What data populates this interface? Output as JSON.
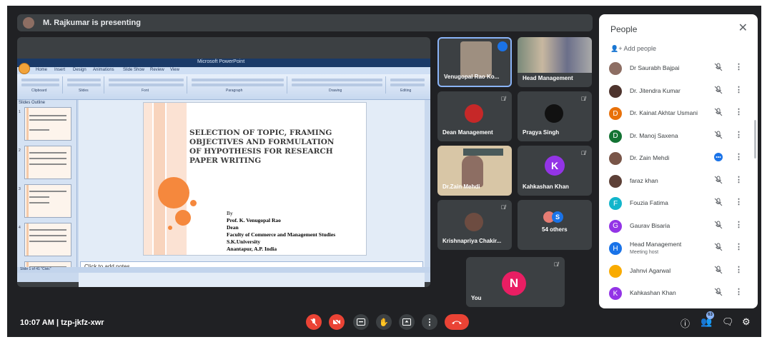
{
  "presenter": {
    "text": "M. Rajkumar is presenting"
  },
  "powerpoint": {
    "window_title": "Microsoft PowerPoint",
    "tabs": [
      "Home",
      "Insert",
      "Design",
      "Animations",
      "Slide Show",
      "Review",
      "View"
    ],
    "ribbon_groups": [
      "Clipboard",
      "Slides",
      "Font",
      "Paragraph",
      "Drawing",
      "Editing"
    ],
    "panel_tabs": "Slides  Outline",
    "notes_placeholder": "Click to add notes",
    "status": "Slide 1 of 41   \"Civic\"",
    "slide": {
      "title": "SELECTION OF TOPIC, FRAMING OBJECTIVES AND FORMULATION OF HYPOTHESIS FOR RESEARCH PAPER WRITING",
      "by": "By",
      "lines": [
        "Prof. K. Venugopal Rao",
        "Dean",
        "Faculty of Commerce and Management Studies",
        "S.K.University",
        "Anantapur, A.P. India"
      ]
    }
  },
  "tiles": [
    {
      "name": "Venugopal Rao Ko..."
    },
    {
      "name": "Head Management"
    },
    {
      "name": "Dean Management"
    },
    {
      "name": "Pragya Singh"
    },
    {
      "name": "Dr.Zain Mehdi"
    },
    {
      "name": "Kahkashan Khan",
      "initial": "K"
    },
    {
      "name": "Krishnapriya Chakir..."
    },
    {
      "name": "54 others",
      "initial": "S"
    },
    {
      "name": "You",
      "initial": "N"
    }
  ],
  "people_panel": {
    "title": "People",
    "add_label": "Add people",
    "list": [
      {
        "name": "Dr Saurabh Bajpai",
        "initial": "",
        "color": "#8d6e63"
      },
      {
        "name": "Dr. Jitendra Kumar",
        "initial": "",
        "color": "#4e342e"
      },
      {
        "name": "Dr. Kainat Akhtar Usmani",
        "initial": "D",
        "color": "#e8710a"
      },
      {
        "name": "Dr. Manoj Saxena",
        "initial": "D",
        "color": "#137333"
      },
      {
        "name": "Dr. Zain Mehdi",
        "initial": "",
        "color": "#795548"
      },
      {
        "name": "faraz khan",
        "initial": "",
        "color": "#5d4037"
      },
      {
        "name": "Fouzia Fatima",
        "initial": "F",
        "color": "#12b5cb"
      },
      {
        "name": "Gaurav Bisaria",
        "initial": "G",
        "color": "#9334e6"
      },
      {
        "name": "Head Management",
        "initial": "H",
        "color": "#1a73e8",
        "sub": "Meeting host"
      },
      {
        "name": "Jahnvi Agarwal",
        "initial": "",
        "color": "#f9ab00"
      },
      {
        "name": "Kahkashan Khan",
        "initial": "K",
        "color": "#9334e6"
      }
    ]
  },
  "bottom": {
    "meeting_info": "10:07 AM  |  tzp-jkfz-xwr",
    "participant_count": "63"
  },
  "colors": {
    "background": "#202124",
    "tile": "#3c4043",
    "danger": "#ea4335",
    "accent": "#1a73e8"
  }
}
